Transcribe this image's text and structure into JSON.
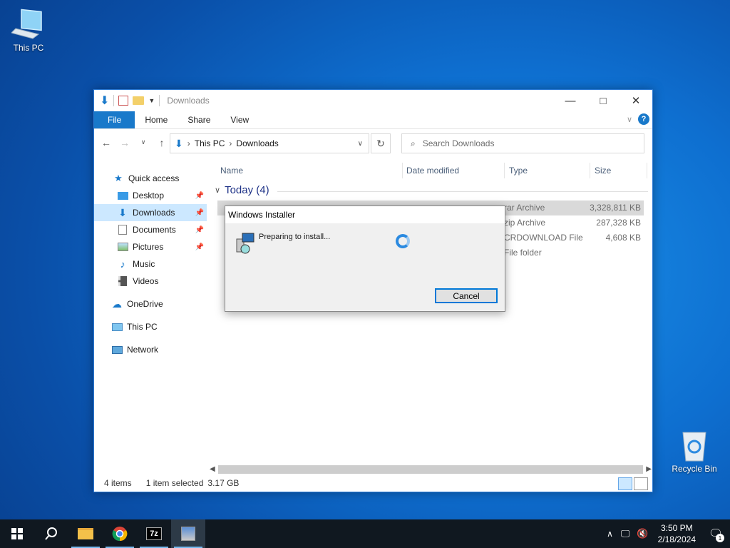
{
  "desktop": {
    "icons": [
      {
        "label": "This PC",
        "icon": "this-pc-icon"
      },
      {
        "label": "Recycle Bin",
        "icon": "recycle-bin-icon"
      }
    ]
  },
  "explorer": {
    "title": "Downloads",
    "tabs": [
      {
        "label": "File"
      },
      {
        "label": "Home"
      },
      {
        "label": "Share"
      },
      {
        "label": "View"
      }
    ],
    "address": {
      "crumbs": [
        "This PC",
        "Downloads"
      ]
    },
    "search": {
      "placeholder": "Search Downloads"
    },
    "nav": {
      "quick_access": "Quick access",
      "items": [
        {
          "label": "Desktop",
          "pinned": true
        },
        {
          "label": "Downloads",
          "pinned": true,
          "selected": true
        },
        {
          "label": "Documents",
          "pinned": true
        },
        {
          "label": "Pictures",
          "pinned": true
        },
        {
          "label": "Music",
          "pinned": false
        },
        {
          "label": "Videos",
          "pinned": false
        }
      ],
      "onedrive": "OneDrive",
      "this_pc": "This PC",
      "network": "Network"
    },
    "columns": [
      "Name",
      "Date modified",
      "Type",
      "Size"
    ],
    "group": "Today (4)",
    "files": [
      {
        "type": "rar Archive",
        "size": "3,328,811 KB",
        "selected": true
      },
      {
        "type": "zip Archive",
        "size": "287,328 KB"
      },
      {
        "type": "CRDOWNLOAD File",
        "size": "4,608 KB"
      },
      {
        "type": "File folder",
        "size": ""
      }
    ],
    "status": {
      "items": "4 items",
      "selected": "1 item selected",
      "size": "3.17 GB"
    }
  },
  "installer": {
    "title": "Windows Installer",
    "message": "Preparing to install...",
    "cancel": "Cancel"
  },
  "taskbar": {
    "apps": [
      "start",
      "search",
      "file-explorer",
      "chrome",
      "7zip",
      "installer"
    ],
    "clock": {
      "time": "3:50 PM",
      "date": "2/18/2024"
    },
    "notifications": "1"
  },
  "colors": {
    "accent": "#1979ca",
    "selection": "#cce8ff",
    "taskbar": "#101820"
  }
}
